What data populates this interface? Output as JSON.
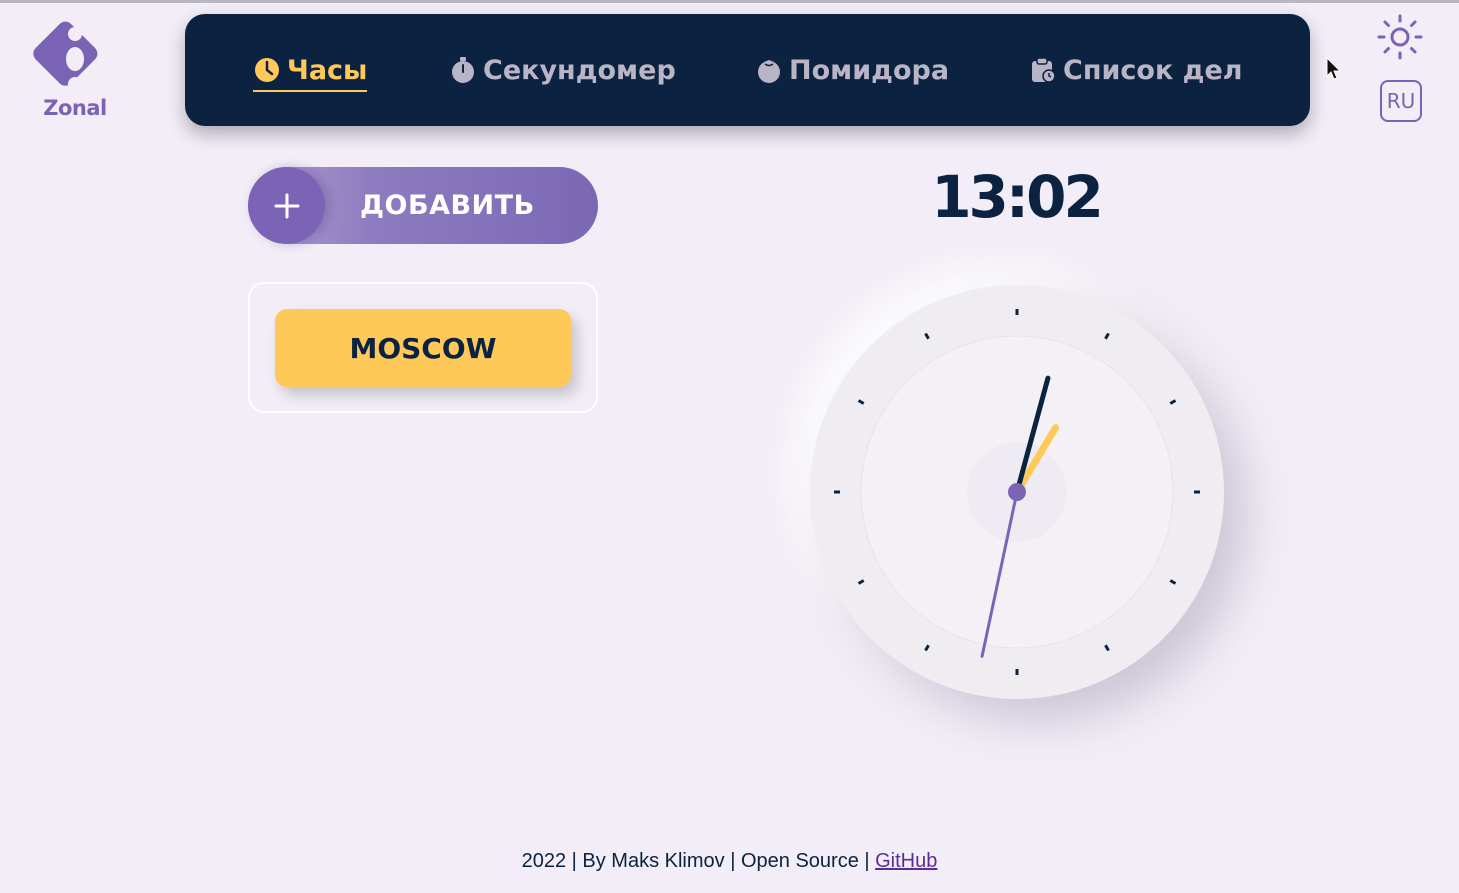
{
  "app": {
    "logo_text": "Zonal"
  },
  "nav": {
    "items": [
      {
        "label": "Часы",
        "icon": "clock-icon",
        "active": true
      },
      {
        "label": "Секундомер",
        "icon": "stopwatch-icon",
        "active": false
      },
      {
        "label": "Помидора",
        "icon": "tomato-icon",
        "active": false
      },
      {
        "label": "Список дел",
        "icon": "clipboard-icon",
        "active": false
      }
    ]
  },
  "controls": {
    "theme_icon": "sun-icon",
    "language": "RU"
  },
  "add_button": {
    "label": "ДОБАВИТЬ",
    "icon": "plus-icon"
  },
  "cities": [
    {
      "name": "MOSCOW"
    }
  ],
  "clock": {
    "digital_time": "13:02",
    "hour": 13,
    "minute": 2,
    "second": 32
  },
  "footer": {
    "text": "2022 | By Maks Klimov | Open Source | ",
    "link_label": "GitHub"
  },
  "colors": {
    "navy": "#0b2340",
    "accent_yellow": "#ffc95a",
    "accent_purple": "#7b64b5",
    "background": "#f2edf6"
  }
}
